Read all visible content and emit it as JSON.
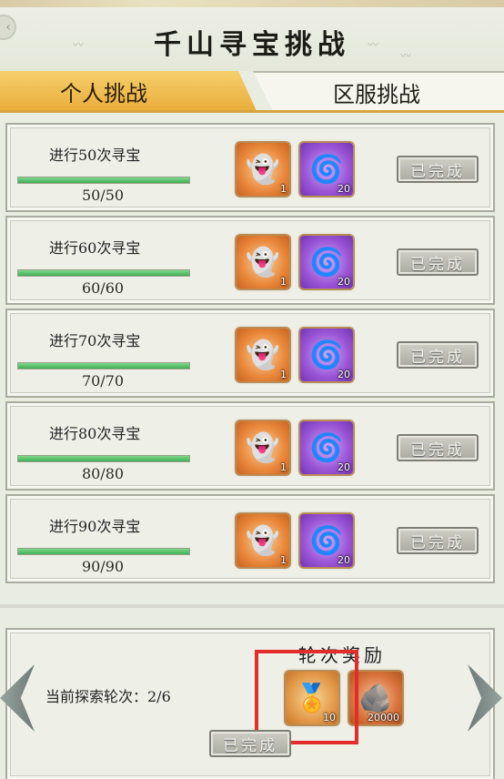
{
  "header": {
    "title": "千山寻宝挑战"
  },
  "tabs": [
    {
      "label": "个人挑战",
      "active": true
    },
    {
      "label": "区服挑战",
      "active": false
    }
  ],
  "challenges": [
    {
      "label": "进行50次寻宝",
      "progress_text": "50/50",
      "progress_fraction": 1.0,
      "rewards": [
        {
          "icon": "blue-ghost-figure-icon",
          "count": "1"
        },
        {
          "icon": "blue-swirl-pouch-icon",
          "count": "20"
        }
      ],
      "button_label": "已完成"
    },
    {
      "label": "进行60次寻宝",
      "progress_text": "60/60",
      "progress_fraction": 1.0,
      "rewards": [
        {
          "icon": "blue-ghost-figure-icon",
          "count": "1"
        },
        {
          "icon": "blue-swirl-pouch-icon",
          "count": "20"
        }
      ],
      "button_label": "已完成"
    },
    {
      "label": "进行70次寻宝",
      "progress_text": "70/70",
      "progress_fraction": 1.0,
      "rewards": [
        {
          "icon": "blue-ghost-figure-icon",
          "count": "1"
        },
        {
          "icon": "blue-swirl-pouch-icon",
          "count": "20"
        }
      ],
      "button_label": "已完成"
    },
    {
      "label": "进行80次寻宝",
      "progress_text": "80/80",
      "progress_fraction": 1.0,
      "rewards": [
        {
          "icon": "blue-ghost-figure-icon",
          "count": "1"
        },
        {
          "icon": "blue-swirl-pouch-icon",
          "count": "20"
        }
      ],
      "button_label": "已完成"
    },
    {
      "label": "进行90次寻宝",
      "progress_text": "90/90",
      "progress_fraction": 1.0,
      "rewards": [
        {
          "icon": "blue-ghost-figure-icon",
          "count": "1"
        },
        {
          "icon": "blue-swirl-pouch-icon",
          "count": "20"
        }
      ],
      "button_label": "已完成"
    }
  ],
  "round_panel": {
    "title": "轮次奖励",
    "current_round_label": "当前探索轮次：2/6",
    "rewards": [
      {
        "icon": "bronze-medal-icon",
        "count": "10"
      },
      {
        "icon": "copper-ore-icon",
        "count": "20000"
      }
    ],
    "button_label": "已完成"
  },
  "colors": {
    "tab_active": "#e9ad3b",
    "progress_fill": "#3fae55",
    "highlight_box": "#e32c2c"
  }
}
